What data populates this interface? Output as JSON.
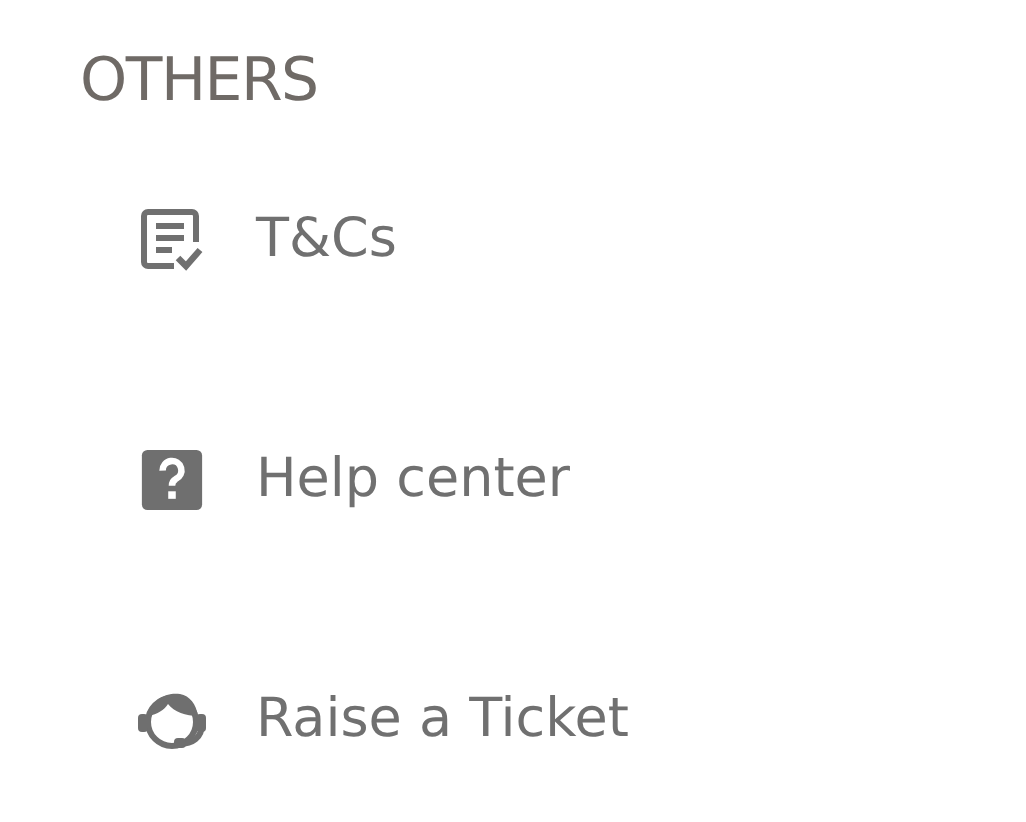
{
  "section": {
    "title": "OTHERS"
  },
  "items": [
    {
      "kind": "terms",
      "label": "T&Cs"
    },
    {
      "kind": "help",
      "label": "Help center"
    },
    {
      "kind": "ticket",
      "label": "Raise a Ticket"
    }
  ]
}
